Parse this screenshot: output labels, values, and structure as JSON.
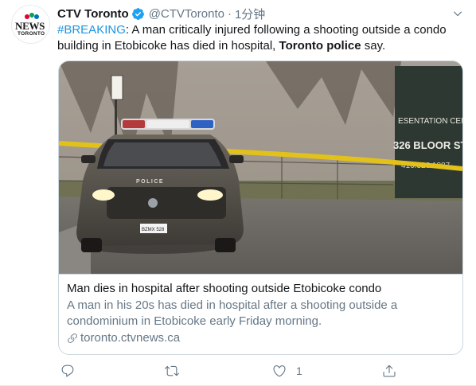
{
  "tweet": {
    "display_name": "CTV Toronto",
    "handle": "@CTVToronto",
    "separator": "·",
    "time": "1分钟",
    "avatar": {
      "logo_text": "NEWS",
      "logo_city": "TORONTO",
      "icon": "ctv-news-logo"
    },
    "text": {
      "hashtag": "#BREAKING",
      "part1": ": A man critically injured following a shooting outside a condo building in Etobicoke has died in hospital, ",
      "mention_bold": "Toronto police",
      "part2": " say."
    },
    "card": {
      "image_alt": "Police cruiser parked by yellow tape near condo building",
      "sign_text_1": "ESENTATION CEN",
      "sign_text_2": "326 BLOOR ST.",
      "sign_text_3": "416.326.1887",
      "car_text": "POLICE",
      "plate_text": "BZMX 528",
      "title": "Man dies in hospital after shooting outside Etobicoke condo",
      "description": "A man in his 20s has died in hospital after a shooting outside a condominium in Etobicoke early Friday morning.",
      "link_text": "toronto.ctvnews.ca",
      "link_icon": "link-icon"
    },
    "actions": {
      "reply_icon": "reply-icon",
      "retweet_icon": "retweet-icon",
      "like_icon": "heart-icon",
      "like_count": "1",
      "share_icon": "share-icon"
    },
    "colors": {
      "link_blue": "#1b95e0",
      "verified_blue": "#1da1f2",
      "muted": "#657786",
      "border": "#ccd6dd"
    }
  }
}
